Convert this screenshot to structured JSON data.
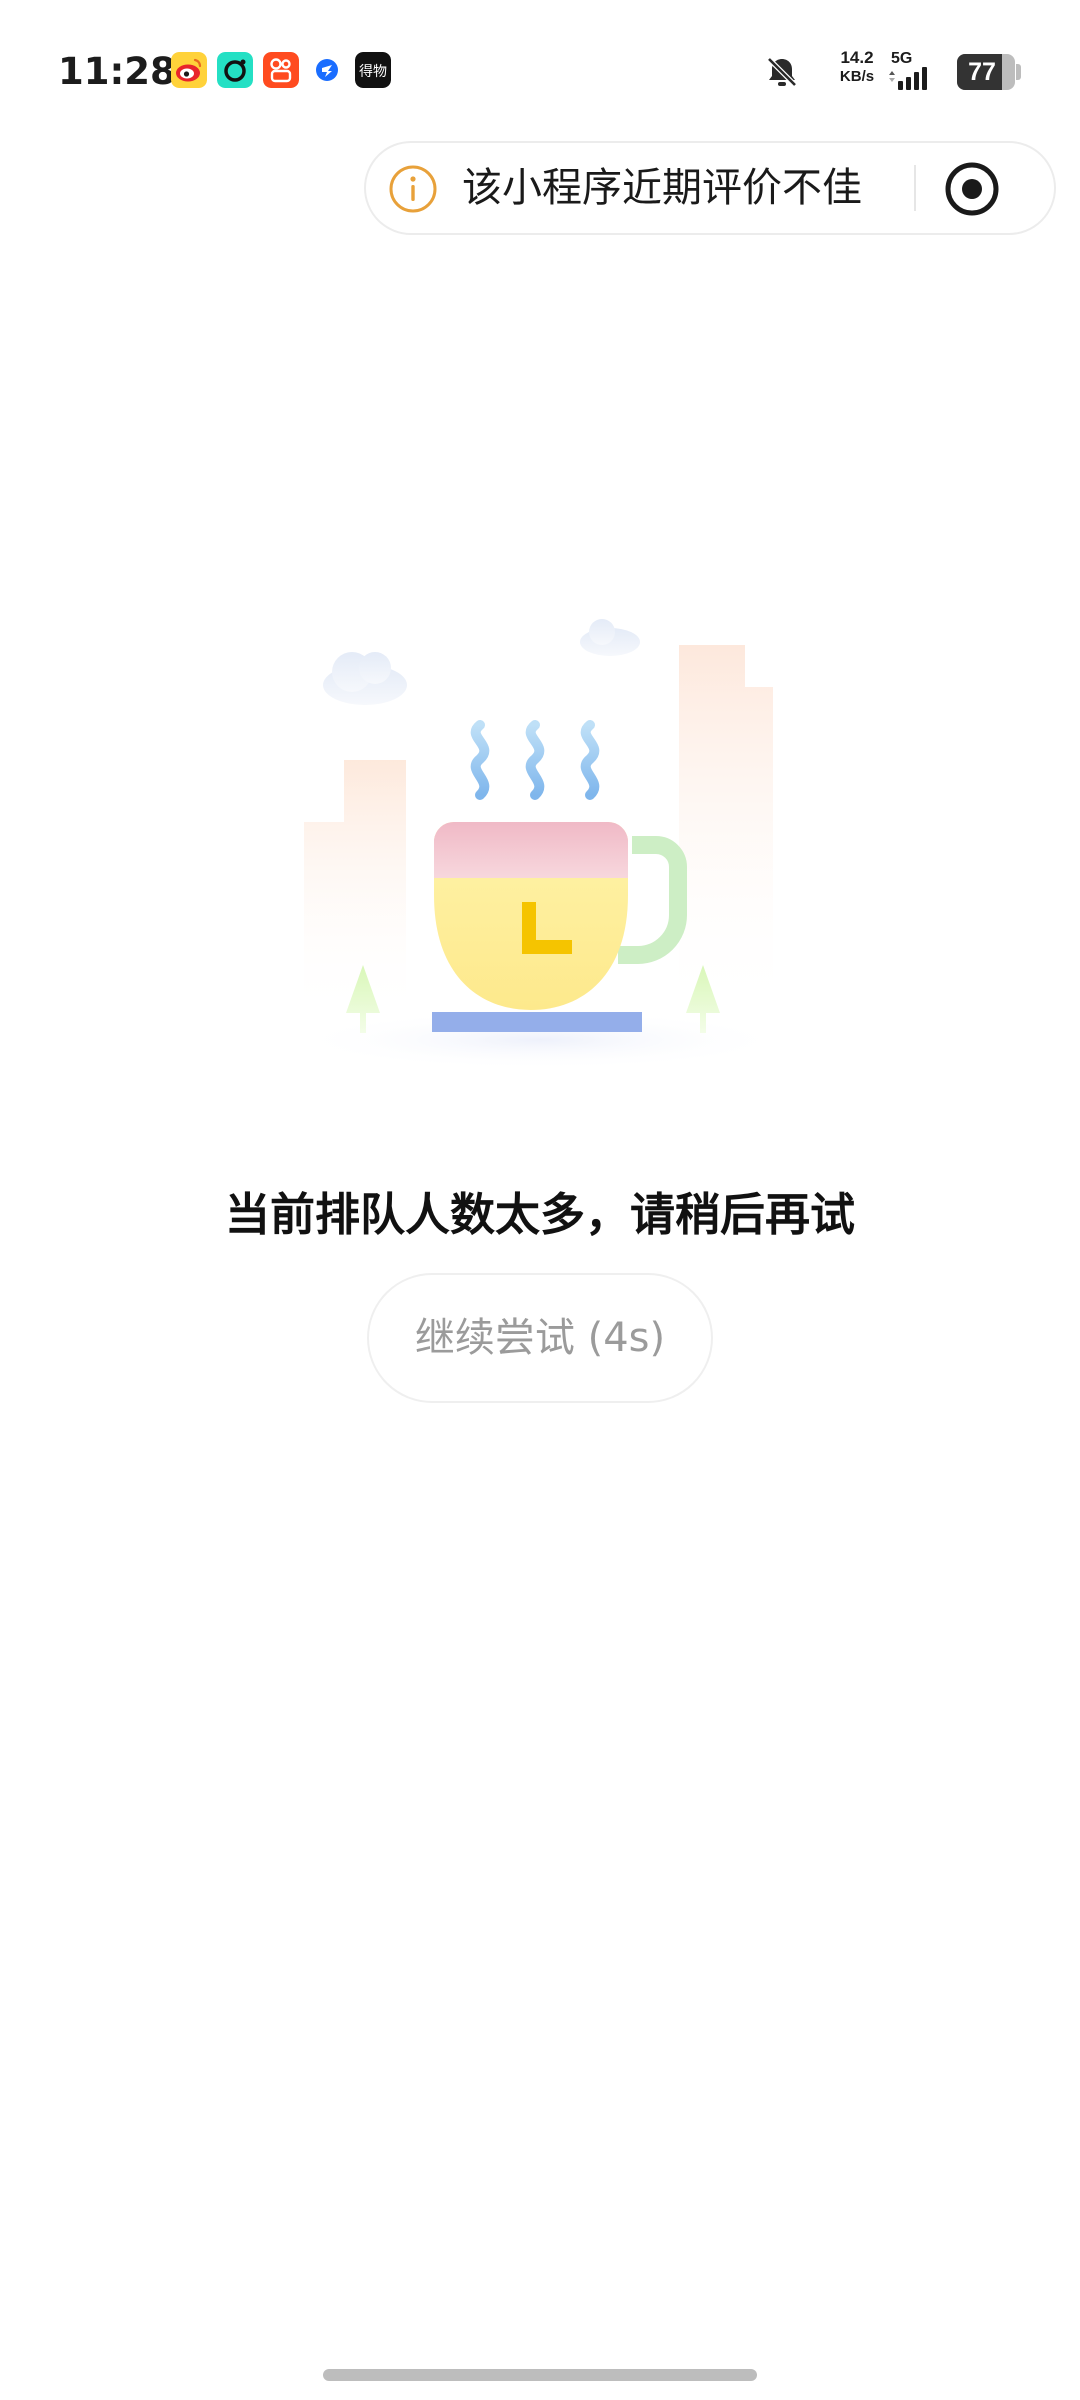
{
  "status_bar": {
    "time": "11:28",
    "notification_icons": [
      "weibo-icon",
      "soul-icon",
      "kuaishou-icon",
      "dingtalk-icon",
      "dewu-icon"
    ],
    "dewu_label": "得物",
    "mute_icon": "bell-off-icon",
    "net_speed_value": "14.2",
    "net_speed_unit": "KB/s",
    "network_type": "5G",
    "signal_icon": "cellular-signal-icon",
    "battery_percent": "77",
    "battery_level": 0.77
  },
  "capsule": {
    "info_icon": "info-circle-icon",
    "notice_text": "该小程序近期评价不佳",
    "target_icon": "target-circle-icon"
  },
  "main": {
    "illustration": "coffee-cup-waiting-illustration",
    "message": "当前排队人数太多，请稍后再试",
    "retry_label": "继续尝试 (4s)"
  },
  "colors": {
    "info_orange": "#e8a13a",
    "text_dark": "#111111",
    "retry_text": "#9b9b9b",
    "cup_yellow": "#fdf0a0",
    "cup_pink": "#f5c4cf",
    "steam_blue": "#9cc9ee",
    "saucer_blue": "#94aeea",
    "handle_green": "#cdeec5"
  }
}
